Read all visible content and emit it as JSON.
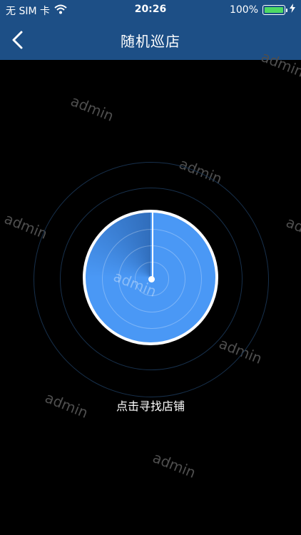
{
  "status_bar": {
    "carrier": "无 SIM 卡",
    "time": "20:26",
    "battery_percent": "100%",
    "battery_level": 1.0,
    "icons": [
      "wifi-icon",
      "battery-icon",
      "charging-icon"
    ]
  },
  "nav": {
    "title": "随机巡店",
    "back_icon": "chevron-left-icon"
  },
  "watermark": "admin",
  "radar": {
    "hint": "点击寻找店铺"
  },
  "colors": {
    "header": "#1d4f86",
    "background": "#000000",
    "radar_fill": "#4a98f5",
    "ring": "#17304c",
    "battery": "#4cd964"
  }
}
